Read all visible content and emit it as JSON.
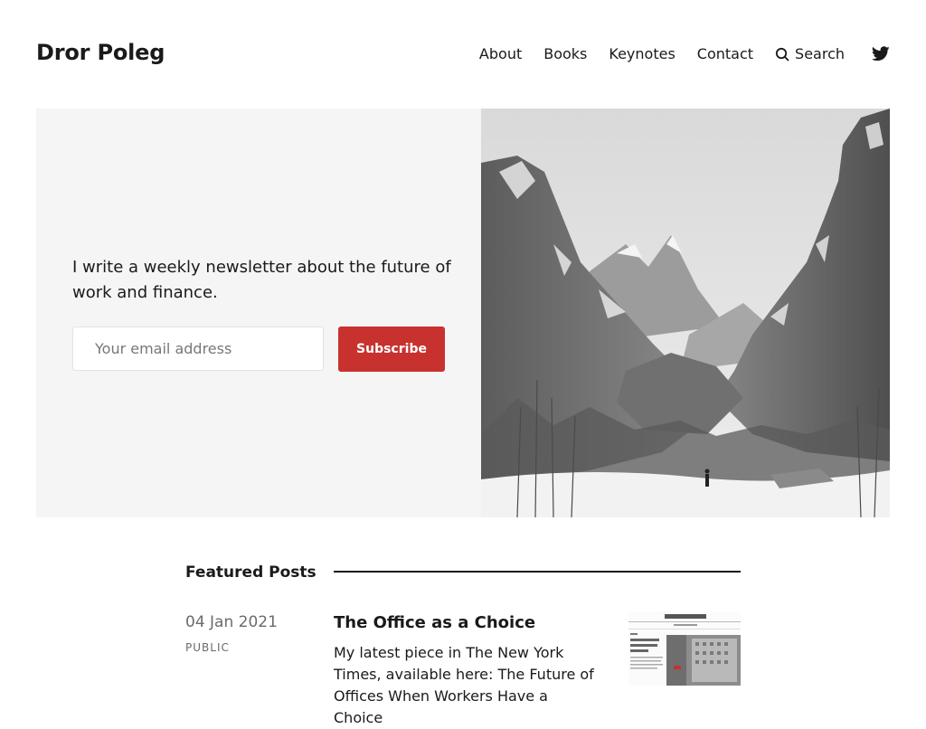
{
  "site": {
    "title": "Dror Poleg"
  },
  "nav": {
    "items": [
      "About",
      "Books",
      "Keynotes",
      "Contact"
    ],
    "search_label": "Search",
    "twitter_icon": "twitter-icon",
    "search_icon": "search-icon"
  },
  "hero": {
    "text": "I write a weekly newsletter about the future of work and finance.",
    "email_placeholder": "Your email address",
    "subscribe_label": "Subscribe",
    "accent_color": "#c8322e"
  },
  "featured": {
    "heading": "Featured Posts",
    "posts": [
      {
        "date": "04 Jan 2021",
        "tag": "PUBLIC",
        "title": "The Office as a Choice",
        "excerpt": "My latest piece in The New York Times, available here: The Future of Offices When Workers Have a Choice"
      }
    ]
  }
}
